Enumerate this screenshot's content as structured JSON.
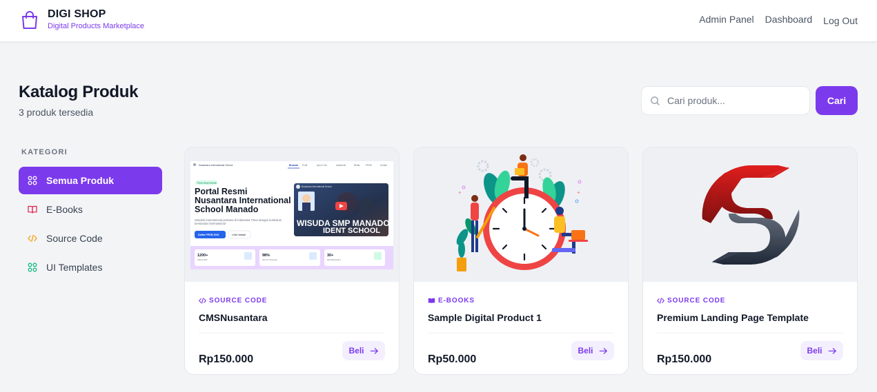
{
  "header": {
    "brand_name": "DIGI SHOP",
    "brand_tagline": "Digital Products Marketplace",
    "nav": [
      {
        "label": "Admin Panel",
        "icon": "none"
      },
      {
        "label": "Dashboard",
        "icon": "none"
      },
      {
        "label": "Log Out",
        "icon": "none"
      }
    ]
  },
  "catalog": {
    "title": "Katalog Produk",
    "subtitle": "3 produk tersedia"
  },
  "search": {
    "placeholder": "Cari produk...",
    "value": "",
    "button_label": "Cari"
  },
  "sidebar": {
    "heading": "KATEGORI",
    "items": [
      {
        "label": "Semua Produk",
        "icon": "grid-icon",
        "active": true
      },
      {
        "label": "E-Books",
        "icon": "book-icon",
        "active": false
      },
      {
        "label": "Source Code",
        "icon": "code-icon",
        "active": false
      },
      {
        "label": "UI Templates",
        "icon": "grid-icon",
        "active": false
      }
    ]
  },
  "products": [
    {
      "category": "SOURCE CODE",
      "category_icon": "code-icon",
      "name": "CMSNusantara",
      "price": "Rp150.000",
      "buy_label": "Beli",
      "thumbnail": {
        "site_name": "Nusantara International School",
        "nav": [
          "Beranda",
          "Profil",
          "Apa & Visi",
          "Akademik",
          "Berita",
          "PPDB",
          "Kontak"
        ],
        "badge": "Portal Sepat Sekolah",
        "headline": "Portal Resmi Nusantara International School Manado",
        "desc": "Sekolah internasional pertama di Indonesia Timur dengan kurikulum berstandar internasional",
        "primary_btn": "Daftar PPDB 2026",
        "secondary_btn": "Lihat Jadwal",
        "video_caption": "WISUDA SMP MANADO",
        "video_caption2": "IDENT SCHOOL",
        "stats": [
          {
            "value": "1200+",
            "label": "Siswa Aktif"
          },
          {
            "value": "98%",
            "label": "Alumni Terserap"
          },
          {
            "value": "30+",
            "label": "Ekstrakurikuler"
          }
        ]
      }
    },
    {
      "category": "E-BOOKS",
      "category_icon": "book-icon",
      "name": "Sample Digital Product 1",
      "price": "Rp50.000",
      "buy_label": "Beli"
    },
    {
      "category": "SOURCE CODE",
      "category_icon": "code-icon",
      "name": "Premium Landing Page Template",
      "price": "Rp150.000",
      "buy_label": "Beli"
    }
  ],
  "colors": {
    "accent": "#7c3aed",
    "accent_soft": "#f3effe",
    "ebook_icon": "#e11d48",
    "code_icon": "#f59e0b",
    "template_icon": "#10b981"
  }
}
